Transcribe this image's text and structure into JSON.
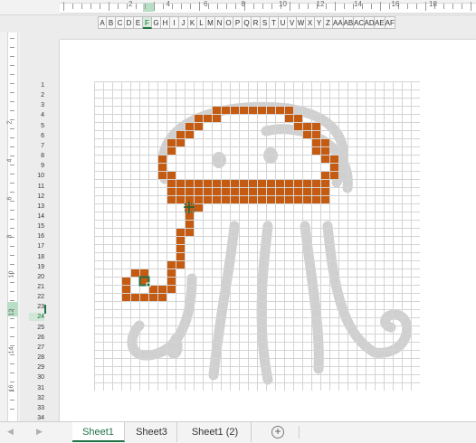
{
  "column_headers": [
    "A",
    "B",
    "C",
    "D",
    "E",
    "F",
    "G",
    "H",
    "I",
    "J",
    "K",
    "L",
    "M",
    "N",
    "O",
    "P",
    "Q",
    "R",
    "S",
    "T",
    "U",
    "V",
    "W",
    "X",
    "Y",
    "Z",
    "AA",
    "AB",
    "AC",
    "AD",
    "AE",
    "AF"
  ],
  "selected_column": "F",
  "row_headers": [
    "1",
    "2",
    "3",
    "4",
    "5",
    "6",
    "7",
    "8",
    "9",
    "10",
    "11",
    "12",
    "13",
    "14",
    "15",
    "16",
    "17",
    "18",
    "19",
    "20",
    "21",
    "22",
    "23",
    "24",
    "25",
    "26",
    "27",
    "28",
    "29",
    "30",
    "31",
    "32",
    "33",
    "34"
  ],
  "selected_row": "24",
  "top_ruler_numbers": [
    "2",
    "4",
    "6",
    "8",
    "10",
    "12",
    "14",
    "16",
    "18"
  ],
  "left_ruler_numbers": [
    "2",
    "4",
    "6",
    "8",
    "10",
    "12",
    "14",
    "16",
    "18"
  ],
  "sheet_tabs": [
    {
      "label": "Sheet1",
      "active": true
    },
    {
      "label": "Sheet3",
      "active": false
    },
    {
      "label": "Sheet1 (2)",
      "active": false
    }
  ],
  "add_sheet_symbol": "+",
  "colors": {
    "fill": "#c55a11",
    "sketch": "#d0d0d0",
    "grid": "#d4d4d4",
    "selection": "#217346"
  }
}
